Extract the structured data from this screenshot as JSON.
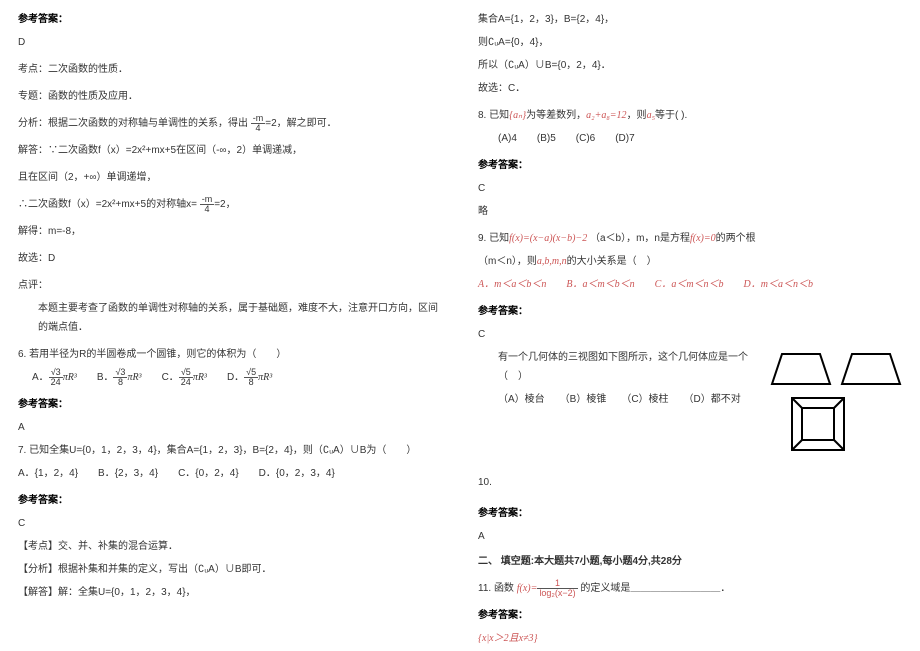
{
  "left": {
    "ans_title": "参考答案：",
    "ans_value": "D",
    "kaodian_lbl": "考点：",
    "kaodian_txt": "二次函数的性质．",
    "zhuanti_lbl": "专题：",
    "zhuanti_txt": "函数的性质及应用．",
    "fenxi_lbl": "分析：",
    "fenxi_txt": "根据二次函数的对称轴与单调性的关系，得出",
    "fenxi_frac_top": "-m",
    "fenxi_frac_bot": "4",
    "fenxi_tail": "=2，解之即可．",
    "jieda_lbl": "解答：",
    "jieda_txt": "∵二次函数f（x）=2x²+mx+5在区间（-∞，2）单调递减，",
    "jieda_line2": "且在区间（2，+∞）单调递增，",
    "jieda_line3_pre": "∴二次函数f（x）=2x²+mx+5的对称轴x=",
    "jieda_line3_frac_top": "-m",
    "jieda_line3_frac_bot": "4",
    "jieda_line3_tail": "=2，",
    "jieda_line4": "解得：m=-8，",
    "jieda_line5": "故选：D",
    "dianping_lbl": "点评：",
    "dianping_txt": "本题主要考查了函数的单调性对称轴的关系，属于基础题，难度不大，注意开口方向，区间的端点值．",
    "q6": "6. 若用半径为R的半圆卷成一个圆锥，则它的体积为（　　）",
    "q6_opts": {
      "A": "A．",
      "A_top": "√3",
      "A_bot": "24",
      "A_tail": "πR³",
      "B": "B．",
      "B_top": "√3",
      "B_bot": "8",
      "B_tail": "πR³",
      "C": "C．",
      "C_top": "√5",
      "C_bot": "24",
      "C_tail": "πR³",
      "D": "D．",
      "D_top": "√5",
      "D_bot": "8",
      "D_tail": "πR³"
    },
    "q6_ans_title": "参考答案：",
    "q6_ans": "A",
    "q7": "7. 已知全集U={0，1，2，3，4}，集合A={1，2，3}，B={2，4}，则（∁ᵤA）∪B为（　　）",
    "q7_line2": "A．{1，2，4}　　B．{2，3，4}　　C．{0，2，4}　　D．{0，2，3，4}",
    "q7_ans_title": "参考答案：",
    "q7_ans": "C",
    "q7_kaodian": "【考点】交、并、补集的混合运算．",
    "q7_fenxi": "【分析】根据补集和并集的定义，写出（∁ᵤA）∪B即可．",
    "q7_jieda": "【解答】解：全集U={0，1，2，3，4}，"
  },
  "right": {
    "l1": "集合A={1，2，3}，B={2，4}，",
    "l2": "则∁ᵤA={0，4}，",
    "l3": "所以（∁ᵤA）∪B={0，2，4}．",
    "l4": "故选：C．",
    "q8_a": "8. 已知",
    "q8_b": "{aₙ}",
    "q8_c": "为等差数列，",
    "q8_d": "a₂+a₈=12",
    "q8_e": "，则",
    "q8_f": "a₅",
    "q8_g": "等于( ).",
    "q8_opts": "(A)4　　(B)5　　(C)6　　(D)7",
    "q8_ans_title": "参考答案：",
    "q8_ans": "C",
    "q8_note": "略",
    "q9_a": "9. 已知",
    "q9_f": "f(x)=(x−a)(x−b)−2",
    "q9_b": "（a＜b），m，n是方程",
    "q9_g": "f(x)=0",
    "q9_c": "的两个根",
    "q9_d": "（m＜n），则",
    "q9_vars": "a,b,m,n",
    "q9_e": "的大小关系是（　）",
    "q9_opts": "A．m＜a＜b＜n　　B．a＜m＜b＜n　　C．a＜m＜n＜b　　D．m＜a＜n＜b",
    "q9_ans_title": "参考答案：",
    "q9_ans": "C",
    "q10a": "有一个几何体的三视图如下图所示，这个几何体应是一个（　）",
    "q10b": "（A）棱台　　（B）棱锥　　（C）棱柱　　（D）都不对",
    "q10_num": "10.",
    "q10_ans_title": "参考答案：",
    "q10_ans": "A",
    "section2": "二、 填空题:本大题共7小题,每小题4分,共28分",
    "q11_a": "11. 函数",
    "q11_frac_top": "1",
    "q11_frac_bot": "log₂(x−2)",
    "q11_b": "的定义域是＿＿＿＿＿＿＿＿＿．",
    "q11_fx": "f(x)=",
    "q11_ans_title": "参考答案：",
    "q11_ans": "{x|x＞2且x≠3}"
  }
}
